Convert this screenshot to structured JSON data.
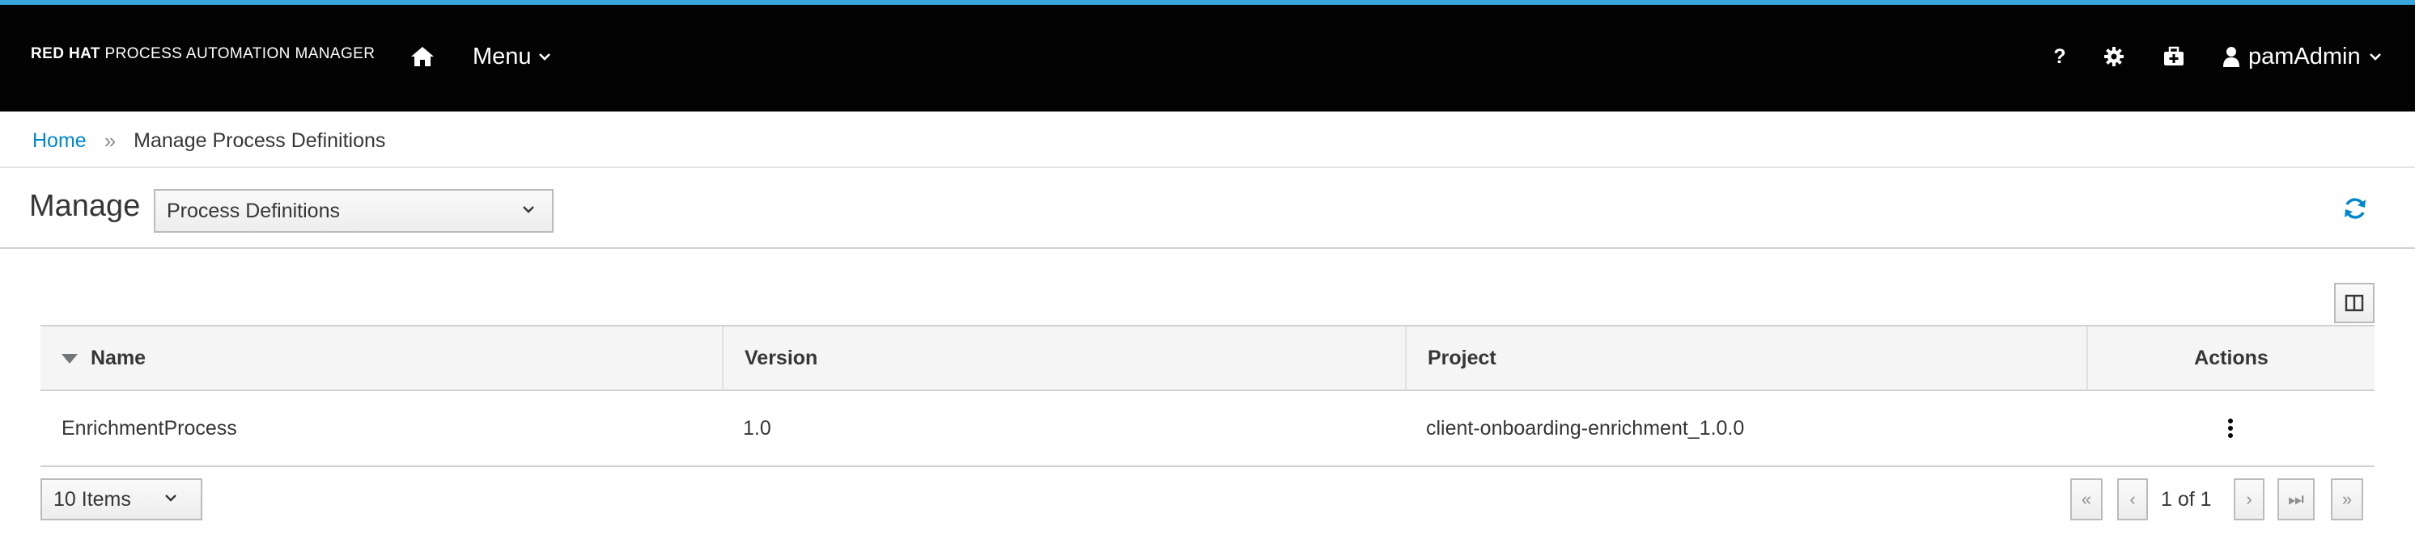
{
  "masthead": {
    "brand_bold": "RED HAT",
    "brand_rest": "PROCESS AUTOMATION MANAGER",
    "menu_label": "Menu",
    "help_label": "?",
    "user_label": "pamAdmin",
    "icons": [
      "home-icon",
      "chevron-down-icon",
      "gear-icon",
      "medkit-icon",
      "user-icon"
    ]
  },
  "breadcrumb": {
    "home": "Home",
    "separator": "»",
    "current": "Manage Process Definitions"
  },
  "toolbar": {
    "title": "Manage",
    "selected_view": "Process Definitions",
    "refresh_icon": "refresh-icon",
    "column_picker_icon": "columns-icon"
  },
  "table": {
    "columns": [
      "Name",
      "Version",
      "Project",
      "Actions"
    ],
    "sorted_by": "Name",
    "rows": [
      {
        "name": "EnrichmentProcess",
        "version": "1.0",
        "project": "client-onboarding-enrichment_1.0.0"
      }
    ]
  },
  "pagination": {
    "per_page": "10 Items",
    "first": "«",
    "prev": "‹",
    "page_text": "1 of 1",
    "next": "›",
    "last": "⏭",
    "more": "»"
  },
  "colors": {
    "accent": "#39a5dc",
    "masthead": "#030303",
    "link": "#0088ce"
  }
}
